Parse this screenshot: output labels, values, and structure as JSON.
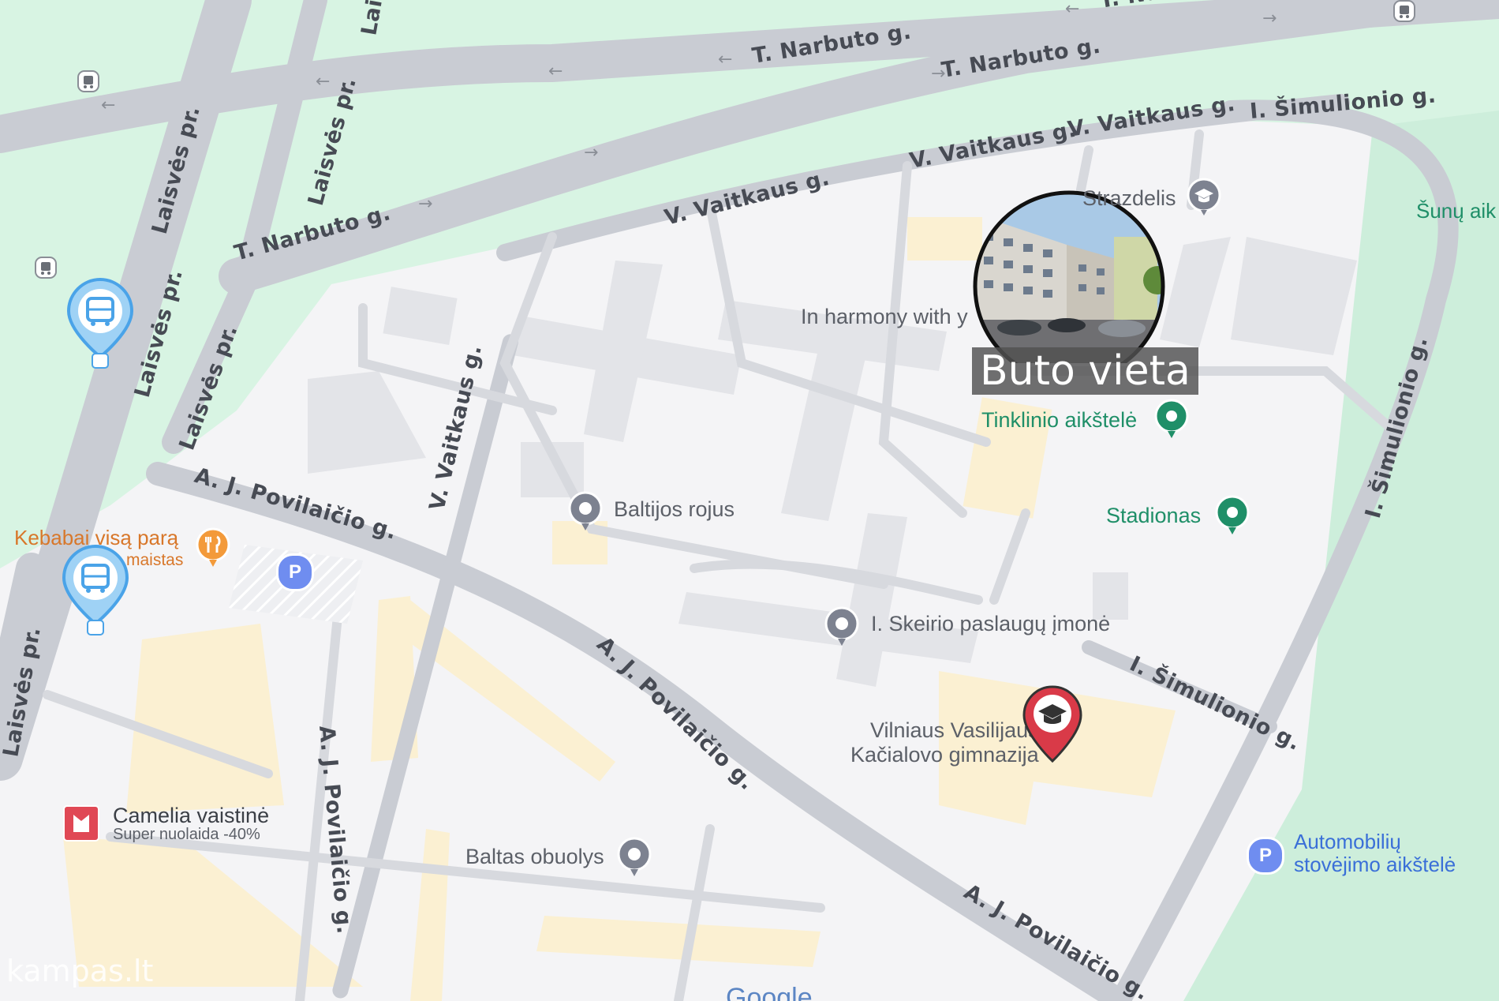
{
  "map": {
    "title_label": "Buto vieta",
    "streets": {
      "narbuto_1": "T. Narbuto g.",
      "narbuto_2": "T. Narbuto g.",
      "narbuto_3": "T. Narbuto g.",
      "narbuto_top": "T. Narb...",
      "vaitkaus_1": "V. Vaitkaus g.",
      "vaitkaus_2": "V. Vaitkaus g.",
      "vaitkaus_3": "V. Vaitkaus g.",
      "vaitkaus_vert": "V. Vaitkaus g.",
      "simulionio_1": "I. Šimulionio g.",
      "simulionio_2": "I. Šimulionio g.",
      "simulionio_3": "I. Šimulionio g.",
      "laisves_1": "Laisvės pr.",
      "laisves_2": "Laisvės pr.",
      "laisves_3": "Laisvės pr.",
      "laisves_4": "Laisvės pr.",
      "laisves_5": "Laisvės pr.",
      "laisves_top": "Laisvės pr.",
      "povilaicio_1": "A. J. Povilaičio g.",
      "povilaicio_2": "A. J. Povilaičio g.",
      "povilaicio_3": "A. J. Povilaičio g.",
      "povilaicio_4": "A. J. Povilaičio g."
    },
    "pois": {
      "strazdelis": "Strazdelis",
      "harmony": "In harmony with y",
      "tinklinio": "Tinklinio aikštelė",
      "stadionas": "Stadionas",
      "baltijos": "Baltijos rojus",
      "skeirio": "I. Skeirio paslaugų įmonė",
      "gimnazija_1": "Vilniaus Vasilijaus",
      "gimnazija_2": "Kačialovo gimnazija",
      "kebabai": "Kebabai visą parą",
      "maistas": "maistas",
      "camelia": "Camelia vaistinė",
      "camelia_sub": "Super nuolaida -40%",
      "baltas": "Baltas obuolys",
      "auto_1": "Automobilių",
      "auto_2": "stovėjimo aikštelė",
      "sunu": "Šunų aik"
    },
    "parking_symbol": "P",
    "watermark": "kampas.lt",
    "google": "Google",
    "colors": {
      "green": "#d7f5e2",
      "road": "#c9ccd3",
      "building": "#e4e5e8",
      "beige": "#fbf0d2",
      "poi_green": "#1f8f68",
      "transit_blue": "#4aa3e8",
      "school_red": "#d93a48"
    }
  }
}
